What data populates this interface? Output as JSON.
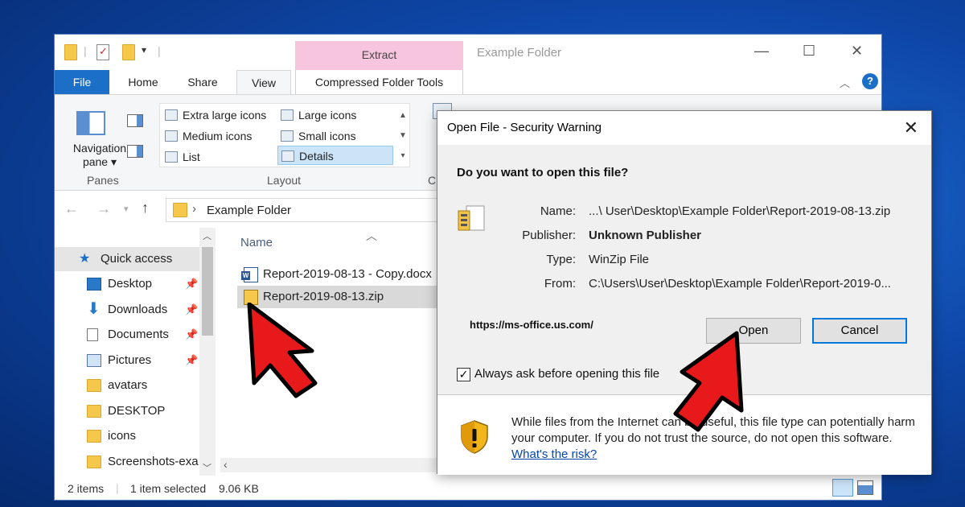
{
  "explorer": {
    "context_tab": "Extract",
    "window_title": "Example Folder",
    "tabs": [
      "File",
      "Home",
      "Share",
      "View"
    ],
    "context_tab_label": "Compressed Folder Tools",
    "ribbon": {
      "navigation_pane_label": "Navigation pane",
      "panes_group": "Panes",
      "layout_group": "Layout",
      "layout_items": [
        "Extra large icons",
        "Large icons",
        "Medium icons",
        "Small icons",
        "List",
        "Details"
      ],
      "selected_layout": "Details",
      "partial_checkbox": "Item check boxes",
      "partial_group": "C"
    },
    "address": {
      "path": "Example Folder"
    },
    "nav_pane": {
      "quick_access": "Quick access",
      "items": [
        "Desktop",
        "Downloads",
        "Documents",
        "Pictures",
        "avatars",
        "DESKTOP",
        "icons",
        "Screenshots-exa"
      ]
    },
    "file_list": {
      "column_name": "Name",
      "files": [
        "Report-2019-08-13 - Copy.docx",
        "Report-2019-08-13.zip"
      ],
      "selected_file": "Report-2019-08-13.zip"
    },
    "status": {
      "item_count": "2 items",
      "selection": "1 item selected",
      "size": "9.06 KB"
    }
  },
  "dialog": {
    "title": "Open File - Security Warning",
    "question": "Do you want to open this file?",
    "fields": {
      "name_label": "Name:",
      "name_value": "...\\ User\\Desktop\\Example Folder\\Report-2019-08-13.zip",
      "publisher_label": "Publisher:",
      "publisher_value": "Unknown Publisher",
      "type_label": "Type:",
      "type_value": "WinZip File",
      "from_label": "From:",
      "from_value": "C:\\Users\\User\\Desktop\\Example Folder\\Report-2019-0..."
    },
    "url": "https://ms-office.us.com/",
    "open_button": "Open",
    "cancel_button": "Cancel",
    "checkbox_label": "Always ask before opening this file",
    "checkbox_checked": true,
    "warning_text": "While files from the Internet can be useful, this file type can potentially harm your computer. If you do not trust the source, do not open this software.",
    "warning_link": "What's the risk?"
  },
  "colors": {
    "accent": "#0078d7",
    "file_tab": "#1c6fc6",
    "context_tab": "#f7c5de",
    "arrow_red": "#e8191b"
  },
  "icons": [
    "folder-icon",
    "properties-icon",
    "navigation-pane-icon",
    "up-arrow-icon",
    "pin-icon",
    "word-doc-icon",
    "zip-file-icon",
    "shield-warning-icon",
    "close-icon",
    "help-icon"
  ]
}
